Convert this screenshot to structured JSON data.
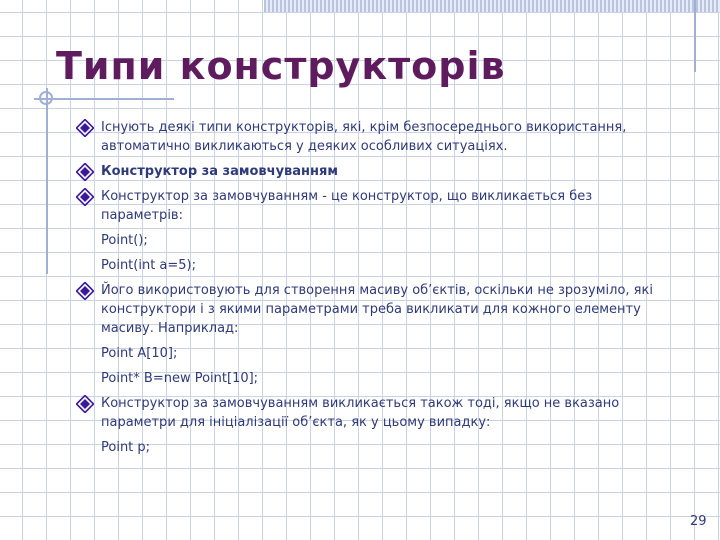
{
  "slide": {
    "title": "Типи конструкторів",
    "page_number": "29",
    "bullet_icon": "diamond-bullet-icon",
    "items": [
      {
        "text": "Існують деякі типи конструкторів, які, крім безпосереднього використання, автоматично викликаються у деяких особливих ситуаціях.",
        "bullet": true,
        "bold": false
      },
      {
        "text": "Конструктор за замовчуванням",
        "bullet": true,
        "bold": true
      },
      {
        "text": "Конструктор за замовчуванням - це конструктор, що викликається без параметрів:",
        "bullet": true,
        "bold": false
      },
      {
        "text": "Point();",
        "bullet": false,
        "bold": false
      },
      {
        "text": "Point(int a=5);",
        "bullet": false,
        "bold": false
      },
      {
        "text": "Його використовують для створення масиву об’єктів, оскільки не зрозуміло, які конструктори і з якими параметрами треба викликати для кожного елементу масиву. Наприклад:",
        "bullet": true,
        "bold": false
      },
      {
        "text": "Point A[10];",
        "bullet": false,
        "bold": false
      },
      {
        "text": "Point* B=new Point[10];",
        "bullet": false,
        "bold": false
      },
      {
        "text": "Конструктор за замовчуванням викликається також тоді, якщо не вказано параметри для ініціалізації об’єкта, як у цьому випадку:",
        "bullet": true,
        "bold": false
      },
      {
        "text": "Point p;",
        "bullet": false,
        "bold": false
      }
    ]
  },
  "colors": {
    "title": "#5e1b5e",
    "text": "#2f3a78",
    "grid": "#c9d3e6",
    "bullet_fill": "#3b1a9a"
  }
}
